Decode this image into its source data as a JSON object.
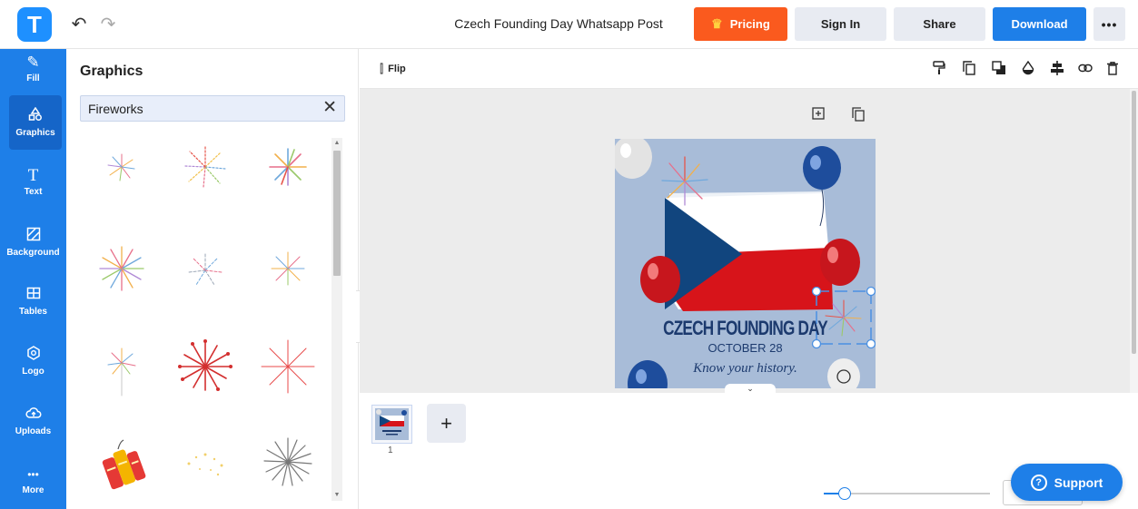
{
  "header": {
    "logo": "T",
    "doc_title": "Czech Founding Day Whatsapp Post",
    "pricing_label": "Pricing",
    "signin_label": "Sign In",
    "share_label": "Share",
    "download_label": "Download",
    "more_label": "•••"
  },
  "sidebar": {
    "items": [
      {
        "label": "Fill",
        "icon": "pen-icon"
      },
      {
        "label": "Graphics",
        "icon": "shapes-icon"
      },
      {
        "label": "Text",
        "icon": "text-icon"
      },
      {
        "label": "Background",
        "icon": "background-icon"
      },
      {
        "label": "Tables",
        "icon": "table-icon"
      },
      {
        "label": "Logo",
        "icon": "logo-icon"
      },
      {
        "label": "Uploads",
        "icon": "cloud-upload-icon"
      },
      {
        "label": "More",
        "icon": "more-dots-icon"
      }
    ]
  },
  "panel": {
    "title": "Graphics",
    "search_value": "Fireworks"
  },
  "toolbar": {
    "flip_label": "Flip"
  },
  "design": {
    "heading": "CZECH FOUNDING DAY",
    "date": "OCTOBER 28",
    "tagline": "Know your history."
  },
  "pages": {
    "thumb_number": "1"
  },
  "support": {
    "label": "Support"
  },
  "colors": {
    "brand_blue": "#1e7fe8",
    "pricing_orange": "#fa5a1e",
    "flag_red": "#d7141a",
    "flag_blue": "#11457e"
  }
}
